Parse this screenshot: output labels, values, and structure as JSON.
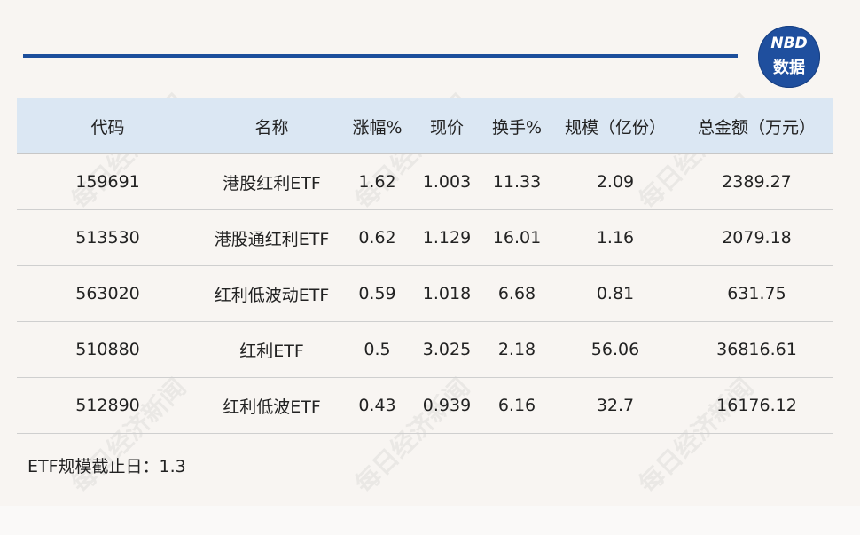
{
  "logo": {
    "line1": "NBD",
    "line2": "数据"
  },
  "table": {
    "headers": [
      "代码",
      "名称",
      "涨幅%",
      "现价",
      "换手%",
      "规模（亿份）",
      "总金额（万元）"
    ],
    "rows": [
      [
        "159691",
        "港股红利ETF",
        "1.62",
        "1.003",
        "11.33",
        "2.09",
        "2389.27"
      ],
      [
        "513530",
        "港股通红利ETF",
        "0.62",
        "1.129",
        "16.01",
        "1.16",
        "2079.18"
      ],
      [
        "563020",
        "红利低波动ETF",
        "0.59",
        "1.018",
        "6.68",
        "0.81",
        "631.75"
      ],
      [
        "510880",
        "红利ETF",
        "0.5",
        "3.025",
        "2.18",
        "56.06",
        "36816.61"
      ],
      [
        "512890",
        "红利低波ETF",
        "0.43",
        "0.939",
        "6.16",
        "32.7",
        "16176.12"
      ]
    ]
  },
  "footnote": "ETF规模截止日：1.3",
  "watermark": "每日经济新闻"
}
